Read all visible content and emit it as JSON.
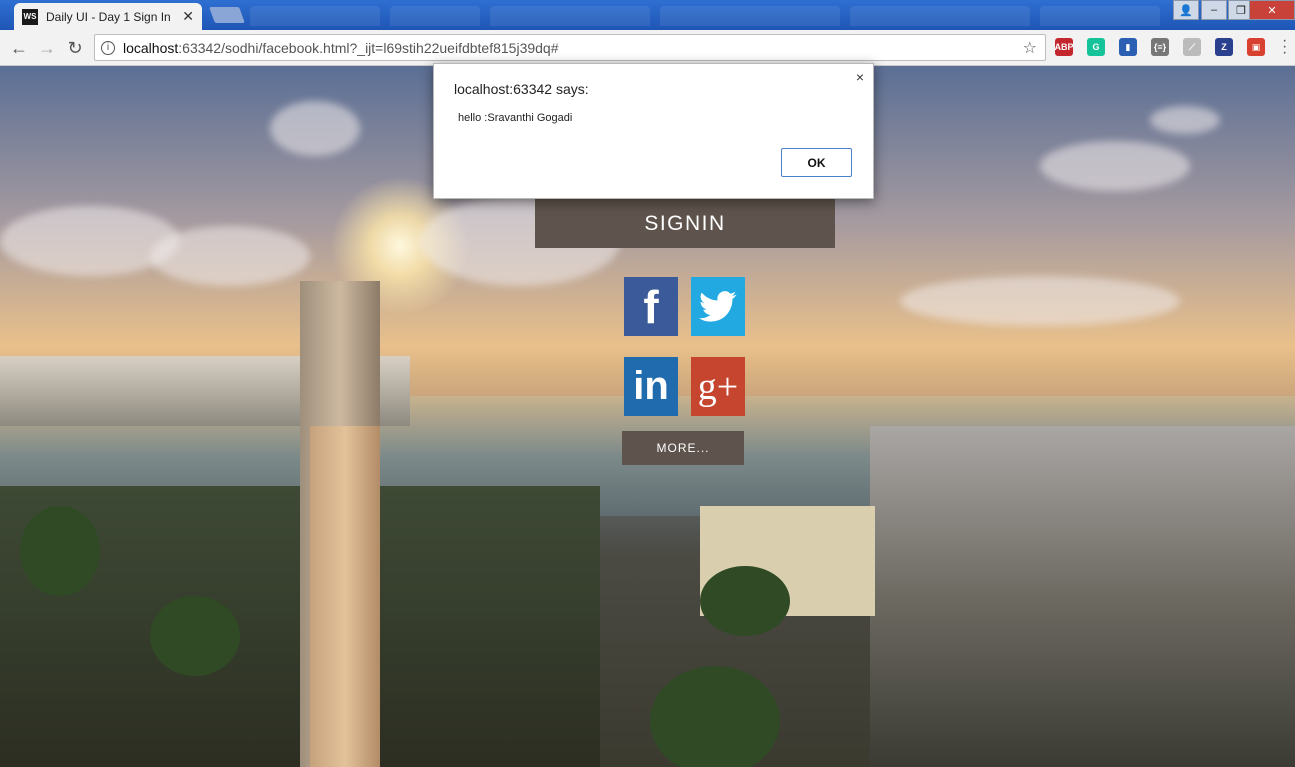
{
  "browser": {
    "tab_title": "Daily UI - Day 1 Sign In",
    "tab_favicon": "WS",
    "url_host": "localhost",
    "url_rest": ":63342/sodhi/facebook.html?_ijt=l69stih22ueifdbtef815j39dq#",
    "extensions": [
      {
        "name": "adblock-plus-icon",
        "label": "ABP",
        "color": "#c4262e"
      },
      {
        "name": "grammarly-icon",
        "label": "G",
        "color": "#15c39a"
      },
      {
        "name": "bookmark-extension-icon",
        "label": "▮",
        "color": "#2b5fb3"
      },
      {
        "name": "json-viewer-icon",
        "label": "{≡}",
        "color": "#777777"
      },
      {
        "name": "stylus-icon",
        "label": "⟋",
        "color": "#bbbbbb"
      },
      {
        "name": "zotero-icon",
        "label": "Z",
        "color": "#2b3f8f"
      },
      {
        "name": "extension-red-icon",
        "label": "▣",
        "color": "#d8412f"
      }
    ]
  },
  "page": {
    "signin_label": "SIGNIN",
    "more_label": "MORE...",
    "social": {
      "facebook": "f",
      "linkedin": "in",
      "googleplus": "g+"
    }
  },
  "alert": {
    "heading": "localhost:63342 says:",
    "message": "hello :Sravanthi Gogadi",
    "ok_label": "OK",
    "close_glyph": "×"
  },
  "colors": {
    "button_brown": "#5f544d",
    "facebook": "#3b5a9a",
    "twitter": "#22a9e1",
    "linkedin": "#1f6bae",
    "googleplus": "#c5452e"
  }
}
